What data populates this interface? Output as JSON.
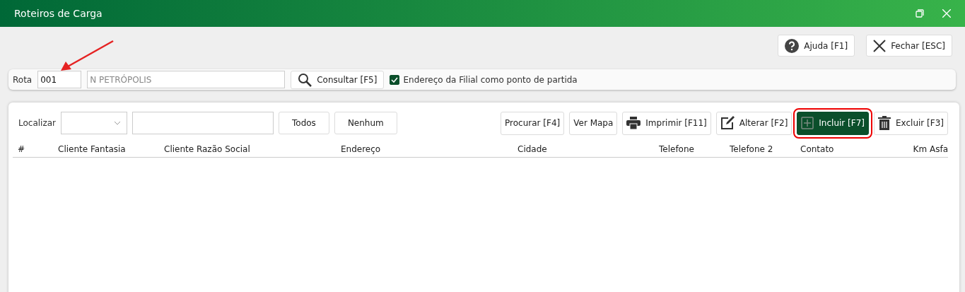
{
  "window": {
    "title": "Roteiros de Carga"
  },
  "top_buttons": [
    {
      "label": "Ajuda [F1]",
      "kind": "help"
    },
    {
      "label": "Fechar [ESC]",
      "kind": "close"
    }
  ],
  "route": {
    "label": "Rota",
    "code": "001",
    "name": "N PETRÓPOLIS",
    "search_button": "Consultar [F5]",
    "checkbox": {
      "label": "Endereço da Filial como ponto de partida",
      "checked": true
    }
  },
  "filter": {
    "label": "Localizar",
    "buttons": [
      "Todos",
      "Nenhum"
    ]
  },
  "actions": [
    {
      "label": "Procurar [F4]",
      "kind": "plain",
      "highlighted": false
    },
    {
      "label": "Ver Mapa",
      "kind": "plain",
      "highlighted": false
    },
    {
      "label": "Imprimir [F11]",
      "kind": "print",
      "highlighted": false
    },
    {
      "label": "Alterar [F2]",
      "kind": "edit",
      "highlighted": false
    },
    {
      "label": "Incluir [F7]",
      "kind": "add",
      "highlighted": true
    },
    {
      "label": "Excluir [F3]",
      "kind": "delete",
      "highlighted": false
    }
  ],
  "table": {
    "columns": [
      "#",
      "Cliente Fantasia",
      "Cliente Razão Social",
      "Endereço",
      "Cidade",
      "Telefone",
      "Telefone 2",
      "Contato",
      "Km Asfa"
    ]
  }
}
